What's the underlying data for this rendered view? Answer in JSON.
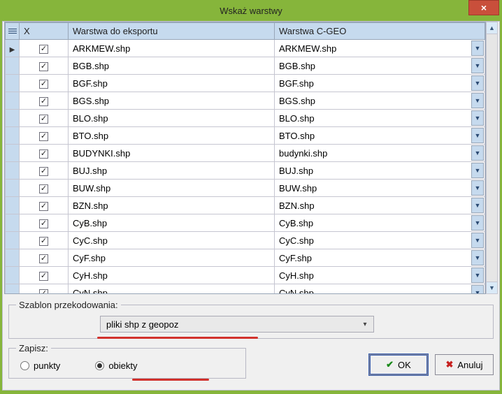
{
  "window": {
    "title": "Wskaż warstwy"
  },
  "table": {
    "headers": {
      "x": "X",
      "export": "Warstwa do eksportu",
      "cgeo": "Warstwa C-GEO"
    },
    "rows": [
      {
        "checked": true,
        "export": "ARKMEW.shp",
        "cgeo": "ARKMEW.shp",
        "current": true
      },
      {
        "checked": true,
        "export": "BGB.shp",
        "cgeo": "BGB.shp"
      },
      {
        "checked": true,
        "export": "BGF.shp",
        "cgeo": "BGF.shp"
      },
      {
        "checked": true,
        "export": "BGS.shp",
        "cgeo": "BGS.shp"
      },
      {
        "checked": true,
        "export": "BLO.shp",
        "cgeo": "BLO.shp"
      },
      {
        "checked": true,
        "export": "BTO.shp",
        "cgeo": "BTO.shp"
      },
      {
        "checked": true,
        "export": "BUDYNKI.shp",
        "cgeo": "budynki.shp"
      },
      {
        "checked": true,
        "export": "BUJ.shp",
        "cgeo": "BUJ.shp"
      },
      {
        "checked": true,
        "export": "BUW.shp",
        "cgeo": "BUW.shp"
      },
      {
        "checked": true,
        "export": "BZN.shp",
        "cgeo": "BZN.shp"
      },
      {
        "checked": true,
        "export": "CyB.shp",
        "cgeo": "CyB.shp"
      },
      {
        "checked": true,
        "export": "CyC.shp",
        "cgeo": "CyC.shp"
      },
      {
        "checked": true,
        "export": "CyF.shp",
        "cgeo": "CyF.shp"
      },
      {
        "checked": true,
        "export": "CyH.shp",
        "cgeo": "CyH.shp"
      },
      {
        "checked": true,
        "export": "CyN.shp",
        "cgeo": "CyN.shp"
      }
    ]
  },
  "template": {
    "legend": "Szablon przekodowania:",
    "selected": "pliki shp z geopoz"
  },
  "save": {
    "legend": "Zapisz:",
    "option_points": "punkty",
    "option_objects": "obiekty",
    "selected": "obiekty"
  },
  "buttons": {
    "ok": "OK",
    "cancel": "Anuluj"
  }
}
